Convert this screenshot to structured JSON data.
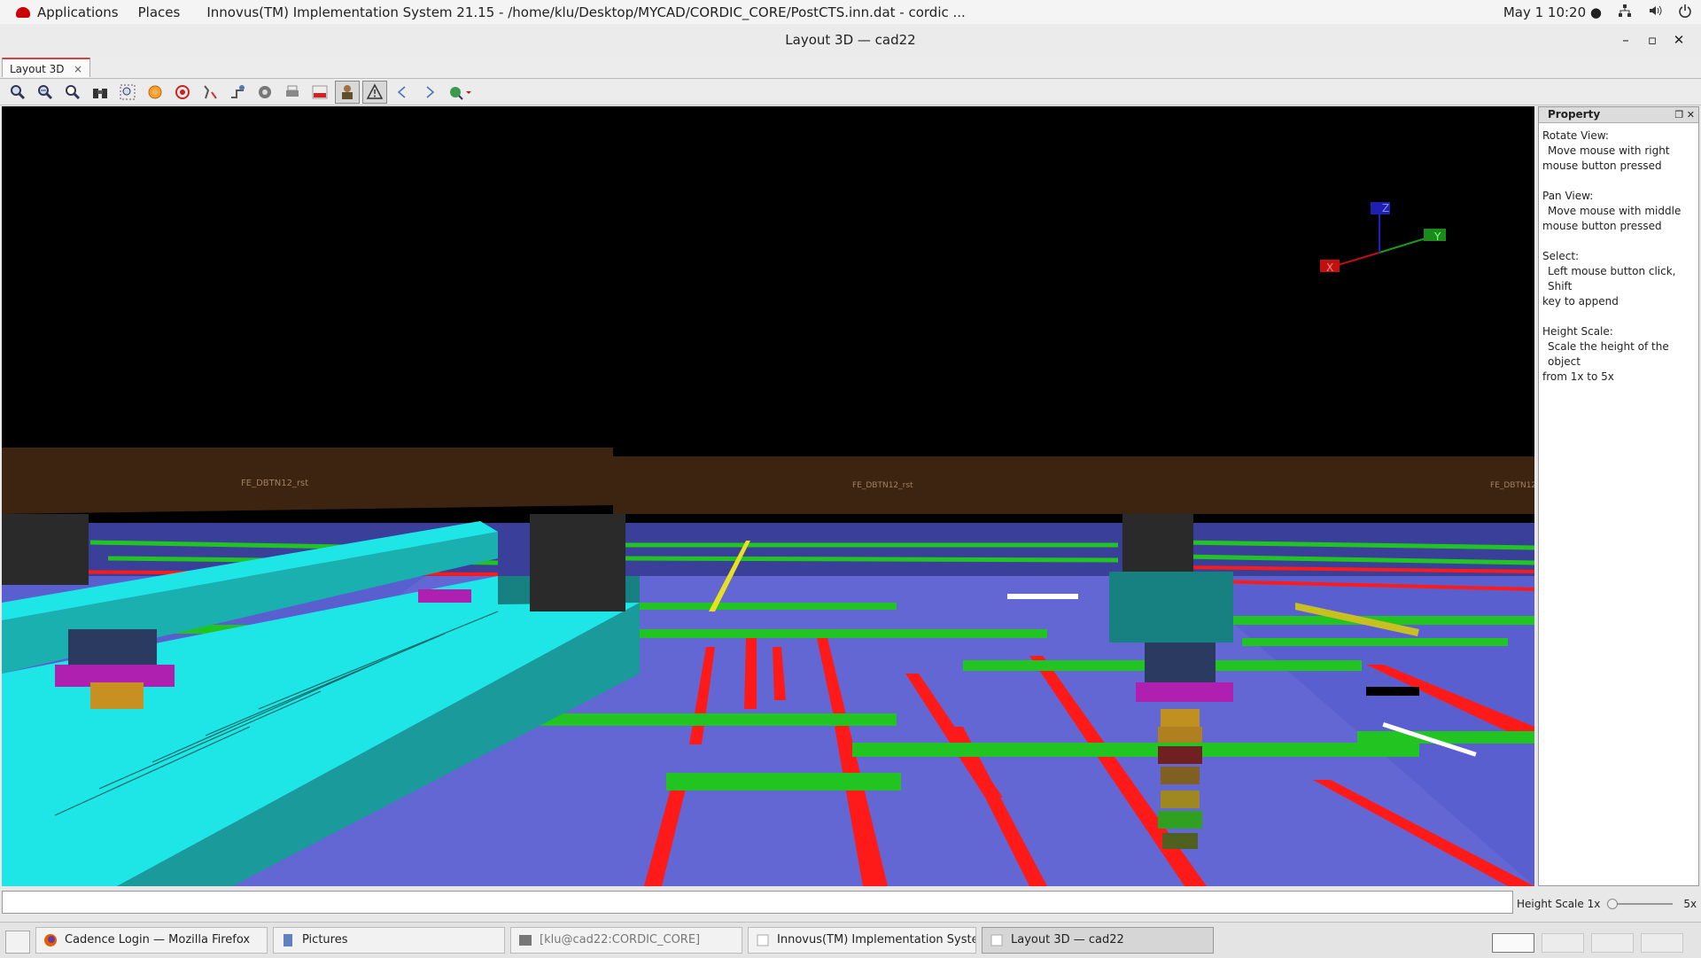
{
  "topbar": {
    "applications": "Applications",
    "places": "Places",
    "window_title": "Innovus(TM) Implementation System 21.15 - /home/klu/Desktop/MYCAD/CORDIC_CORE/PostCTS.inn.dat - cordic ...",
    "datetime": "May 1  10:20 ●"
  },
  "window": {
    "title": "Layout 3D — cad22",
    "minimize": "–",
    "maximize": "▫",
    "close": "✕"
  },
  "tab": {
    "label": "Layout 3D",
    "close": "×"
  },
  "toolbar": {
    "icons": [
      "zoom-in-icon",
      "zoom-out-icon",
      "zoom-fit-icon",
      "binoculars-icon",
      "zoom-area-icon",
      "orange-circle-icon",
      "target-icon",
      "route-icon",
      "net-icon",
      "gear-icon",
      "print-icon",
      "gif-icon",
      "person-icon",
      "warning-icon",
      "back-arrow-icon",
      "forward-arrow-icon",
      "globe-dropdown-icon"
    ]
  },
  "view": {
    "instance_labels": [
      "FE_DBTN12_rst",
      "FE_DBTN12_rst",
      "FE_DBTN12"
    ],
    "axes": {
      "x": "X",
      "y": "Y",
      "z": "Z"
    }
  },
  "property": {
    "title": "Property",
    "sections": [
      {
        "heading": "Rotate View:",
        "line1": "Move mouse with right",
        "line2": "mouse button pressed"
      },
      {
        "heading": "Pan View:",
        "line1": "Move mouse with middle",
        "line2": "mouse button pressed"
      },
      {
        "heading": "Select:",
        "line1": "Left mouse button click, Shift",
        "line2": "key to append"
      },
      {
        "heading": "Height Scale:",
        "line1": "Scale the height of the object",
        "line2": "from 1x to 5x"
      }
    ]
  },
  "height_scale": {
    "label": "Height Scale 1x",
    "max": "5x",
    "value": 1
  },
  "taskbar": {
    "items": [
      {
        "label": "Cadence Login — Mozilla Firefox"
      },
      {
        "label": "Pictures"
      },
      {
        "label": "[klu@cad22:CORDIC_CORE]"
      },
      {
        "label": "Innovus(TM) Implementation Syste..."
      },
      {
        "label": "Layout 3D — cad22"
      }
    ]
  },
  "colors": {
    "background": "#000000",
    "substrate": "#5a5fd0",
    "metal_red": "#ff1a1a",
    "metal_green": "#22c422",
    "power_cyan": "#1ee6e6",
    "cell_brown": "#3d2410",
    "via_magenta": "#b020b0"
  }
}
